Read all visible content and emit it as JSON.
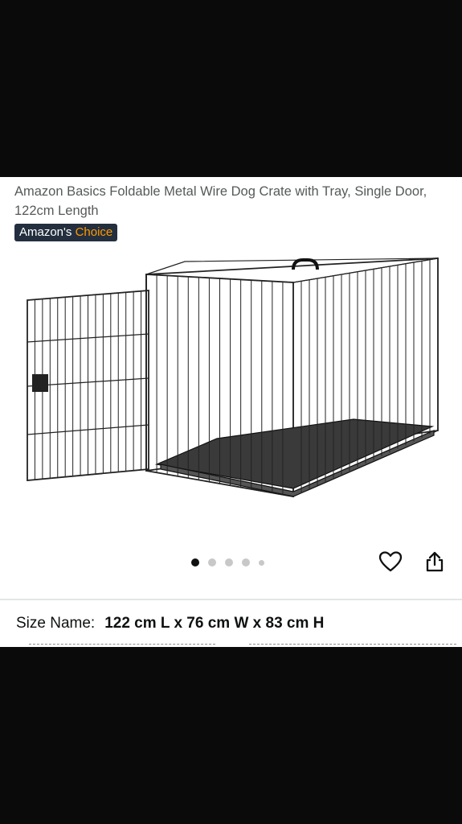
{
  "product": {
    "title": "Amazon Basics Foldable Metal Wire Dog Crate with Tray, Single Door, 122cm Length",
    "badge_main": "Amazon's",
    "badge_accent": "Choice",
    "image_label": "dog-crate-product-image"
  },
  "carousel": {
    "dot_count": 5,
    "active_index": 0
  },
  "actions": {
    "favorite_icon": "heart-icon",
    "share_icon": "share-icon"
  },
  "size": {
    "label": "Size Name:",
    "value": "122 cm L x 76 cm W x 83 cm H"
  },
  "colors": {
    "badge_bg": "#232f3e",
    "badge_accent": "#ff9900",
    "title_text": "#565959"
  }
}
